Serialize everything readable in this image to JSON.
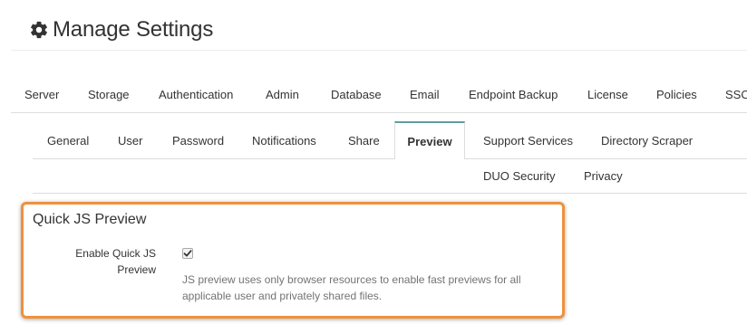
{
  "header": {
    "title": "Manage Settings",
    "icon": "gear-icon"
  },
  "main_tabs": [
    {
      "label": "Server"
    },
    {
      "label": "Storage"
    },
    {
      "label": "Authentication"
    },
    {
      "label": "Admin"
    },
    {
      "label": "Database"
    },
    {
      "label": "Email"
    },
    {
      "label": "Endpoint Backup"
    },
    {
      "label": "License"
    },
    {
      "label": "Policies"
    },
    {
      "label": "SSO"
    }
  ],
  "sub_tabs": [
    {
      "label": "General"
    },
    {
      "label": "User"
    },
    {
      "label": "Password"
    },
    {
      "label": "Notifications"
    },
    {
      "label": "Share"
    },
    {
      "label": "Preview",
      "active": true
    },
    {
      "label": "Support Services"
    },
    {
      "label": "Directory Scraper"
    },
    {
      "label": "DUO Security"
    },
    {
      "label": "Privacy"
    }
  ],
  "section": {
    "title": "Quick JS Preview",
    "field_label_line1": "Enable Quick JS",
    "field_label_line2": "Preview",
    "checkbox_checked": true,
    "help_line1": "JS preview uses only browser resources to enable fast previews for all",
    "help_line2": "applicable user and privately shared files."
  },
  "colors": {
    "highlight_border": "#f0913c",
    "active_tab_accent": "#5f9ea0",
    "help_text": "#737373"
  }
}
